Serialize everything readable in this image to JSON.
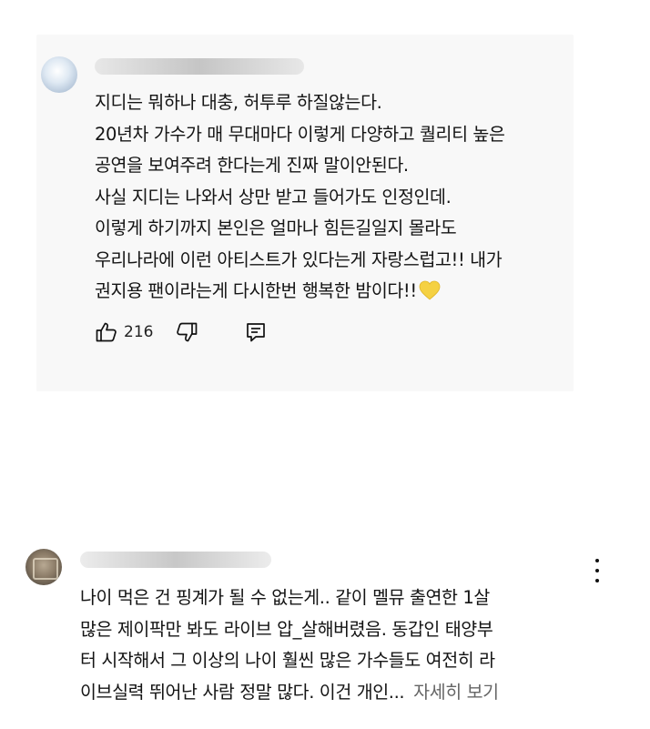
{
  "comments": [
    {
      "lines": [
        "지디는 뭐하나 대충, 허투루 하질않는다.",
        "20년차 가수가 매 무대마다 이렇게 다양하고 퀄리티 높은",
        "공연을 보여주려 한다는게 진짜 말이안된다.",
        "사실 지디는 나와서 상만 받고 들어가도 인정인데.",
        "이렇게 하기까지 본인은 얼마나 힘든길일지 몰라도",
        "우리나라에 이런 아티스트가 있다는게 자랑스럽고!! 내가",
        "권지용 팬이라는게 다시한번 행복한 밤이다!!"
      ],
      "emoji_icon": "yellow-heart-icon",
      "like_count": "216"
    },
    {
      "lines": [
        "나이 먹은 건 핑계가 될 수 없는게.. 같이 멜뮤 출연한 1살",
        "많은 제이팍만 봐도 라이브 압_살해버렸음. 동갑인 태양부",
        "터 시작해서  그 이상의 나이 훨씬 많은 가수들도 여전히 라",
        "이브실력 뛰어난 사람 정말 많다. 이건 개인..."
      ],
      "read_more": "자세히 보기"
    }
  ],
  "icons": {
    "like": "thumbs-up-icon",
    "dislike": "thumbs-down-icon",
    "reply": "reply-comment-icon",
    "menu": "more-options-icon"
  },
  "colors": {
    "card_bg": "#f8f8f8",
    "text": "#141414",
    "read_more": "#666666",
    "heart": "#f5d142"
  }
}
